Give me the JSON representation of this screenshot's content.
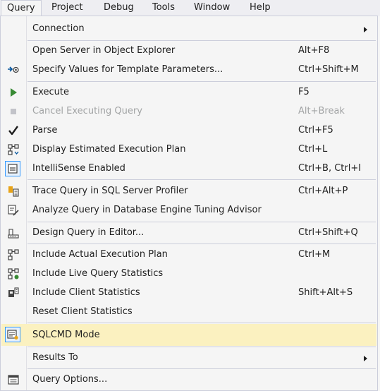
{
  "menubar": {
    "items": [
      {
        "label": "Query"
      },
      {
        "label": "Project"
      },
      {
        "label": "Debug"
      },
      {
        "label": "Tools"
      },
      {
        "label": "Window"
      },
      {
        "label": "Help"
      }
    ]
  },
  "menu": {
    "items": [
      {
        "label": "Connection",
        "shortcut": "",
        "icon": "",
        "submenu": true
      },
      {
        "label": "Open Server in Object Explorer",
        "shortcut": "Alt+F8",
        "icon": ""
      },
      {
        "label": "Specify Values for Template Parameters...",
        "shortcut": "Ctrl+Shift+M",
        "icon": "template-parameters-icon"
      },
      {
        "label": "Execute",
        "shortcut": "F5",
        "icon": "execute-play-icon"
      },
      {
        "label": "Cancel Executing Query",
        "shortcut": "Alt+Break",
        "icon": "stop-icon",
        "disabled": true
      },
      {
        "label": "Parse",
        "shortcut": "Ctrl+F5",
        "icon": "checkmark-icon"
      },
      {
        "label": "Display Estimated Execution Plan",
        "shortcut": "Ctrl+L",
        "icon": "execution-plan-icon"
      },
      {
        "label": "IntelliSense Enabled",
        "shortcut": "Ctrl+B, Ctrl+I",
        "icon": "intellisense-icon",
        "checked": true
      },
      {
        "label": "Trace Query in SQL Server Profiler",
        "shortcut": "Ctrl+Alt+P",
        "icon": "profiler-icon"
      },
      {
        "label": "Analyze Query in Database Engine Tuning Advisor",
        "shortcut": "",
        "icon": "tuning-advisor-icon"
      },
      {
        "label": "Design Query in Editor...",
        "shortcut": "Ctrl+Shift+Q",
        "icon": "query-designer-icon"
      },
      {
        "label": "Include Actual Execution Plan",
        "shortcut": "Ctrl+M",
        "icon": "actual-plan-icon"
      },
      {
        "label": "Include Live Query Statistics",
        "shortcut": "",
        "icon": "live-statistics-icon"
      },
      {
        "label": "Include Client Statistics",
        "shortcut": "Shift+Alt+S",
        "icon": "client-statistics-icon"
      },
      {
        "label": "Reset Client Statistics",
        "shortcut": "",
        "icon": ""
      },
      {
        "label": "SQLCMD Mode",
        "shortcut": "",
        "icon": "sqlcmd-icon",
        "highlighted": true
      },
      {
        "label": "Results To",
        "shortcut": "",
        "icon": "",
        "submenu": true
      },
      {
        "label": "Query Options...",
        "shortcut": "",
        "icon": "query-options-icon"
      }
    ]
  },
  "colors": {
    "highlight": "#fbf1c0",
    "execute_green": "#388a34",
    "icon_blue": "#00539c",
    "icon_gray": "#424242"
  }
}
